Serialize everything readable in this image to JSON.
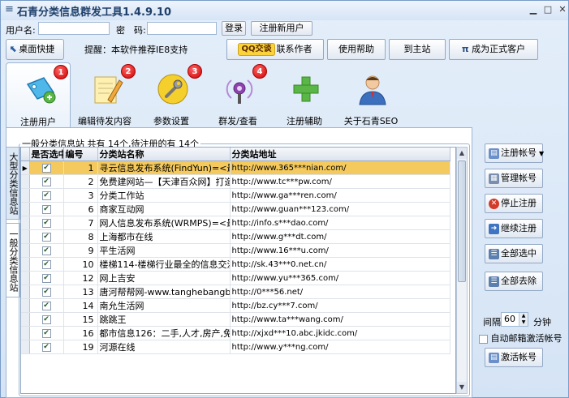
{
  "window": {
    "title": "石青分类信息群发工具1.4.9.10",
    "controls": [
      "minimize-icon",
      "maximize-icon",
      "close-icon"
    ]
  },
  "login": {
    "username_label": "用户名:",
    "username_value": "",
    "password_label": "密　码:",
    "password_value": "",
    "login_button": "登录",
    "register_button": "注册新用户"
  },
  "topbar": {
    "desktop_shortcut": "桌面快捷",
    "notice": "提醒：本软件推荐IE8支持",
    "qq_badge": "QQ交谈",
    "contact_author": "联系作者",
    "help": "使用帮助",
    "to_site": "到主站",
    "become_member": "成为正式客户"
  },
  "tools": [
    {
      "label": "注册用户",
      "badge": "1",
      "icon": "tag-user-icon"
    },
    {
      "label": "编辑待发内容",
      "badge": "2",
      "icon": "edit-notepad-icon"
    },
    {
      "label": "参数设置",
      "badge": "3",
      "icon": "wrench-settings-icon"
    },
    {
      "label": "群发/查看",
      "badge": "4",
      "icon": "radio-broadcast-icon"
    },
    {
      "label": "注册辅助",
      "badge": "",
      "icon": "plus-icon"
    },
    {
      "label": "关于石青SEO",
      "badge": "",
      "icon": "person-icon"
    }
  ],
  "side_tabs": [
    "大型分类信息站",
    "一般分类信息站"
  ],
  "group_caption": "一般分类信息站 共有 14个,待注册的有 14个",
  "grid": {
    "columns": [
      "是否选中",
      "编号",
      "分类站名称",
      "分类站地址"
    ],
    "rows": [
      {
        "checked": true,
        "no": "1",
        "name": "寻云信息发布系统(FindYun)=<最",
        "url": "http://www.365***nian.com/",
        "selected": true
      },
      {
        "checked": true,
        "no": "2",
        "name": "免费建网站—【天津百众网】打造",
        "url": "http://www.tc***pw.com/"
      },
      {
        "checked": true,
        "no": "3",
        "name": "分类工作站",
        "url": "http://www.ga***ren.com/"
      },
      {
        "checked": true,
        "no": "6",
        "name": "商家互动网",
        "url": "http://www.guan***123.com/"
      },
      {
        "checked": true,
        "no": "7",
        "name": "网人信息发布系统(WRMPS)=<最",
        "url": "http://info.s***dao.com/"
      },
      {
        "checked": true,
        "no": "8",
        "name": "上海都市在线",
        "url": "http://www.g***dt.com/"
      },
      {
        "checked": true,
        "no": "9",
        "name": "平生活网",
        "url": "http://www.16***u.com/"
      },
      {
        "checked": true,
        "no": "10",
        "name": "楼梯114-楼梯行业最全的信息交流",
        "url": "http://sk.43***0.net.cn/"
      },
      {
        "checked": true,
        "no": "12",
        "name": "网上吉安",
        "url": "http://www.yu***365.com/"
      },
      {
        "checked": true,
        "no": "13",
        "name": "唐河帮帮网-www.tanghebangbang",
        "url": "http://0***56.net/"
      },
      {
        "checked": true,
        "no": "14",
        "name": "南允生活网",
        "url": "http://bz.cy***7.com/"
      },
      {
        "checked": true,
        "no": "15",
        "name": "跳跳王",
        "url": "http://www.ta***wang.com/"
      },
      {
        "checked": true,
        "no": "16",
        "name": "都市信息126：二手,人才,房产,免费",
        "url": "http://xjxd***10.abc.jkidc.com/"
      },
      {
        "checked": true,
        "no": "19",
        "name": "河源在线",
        "url": "http://www.y***ng.com/"
      }
    ]
  },
  "right_panel": {
    "register_account": "注册帐号",
    "manage_account": "管理帐号",
    "stop_register": "停止注册",
    "continue_register": "继续注册",
    "select_all": "全部选中",
    "deselect_all": "全部去除",
    "interval_label": "间隔",
    "interval_value": "60",
    "interval_unit": "分钟",
    "auto_activate": "自动邮箱激活帐号",
    "activate_account": "激活帐号"
  }
}
